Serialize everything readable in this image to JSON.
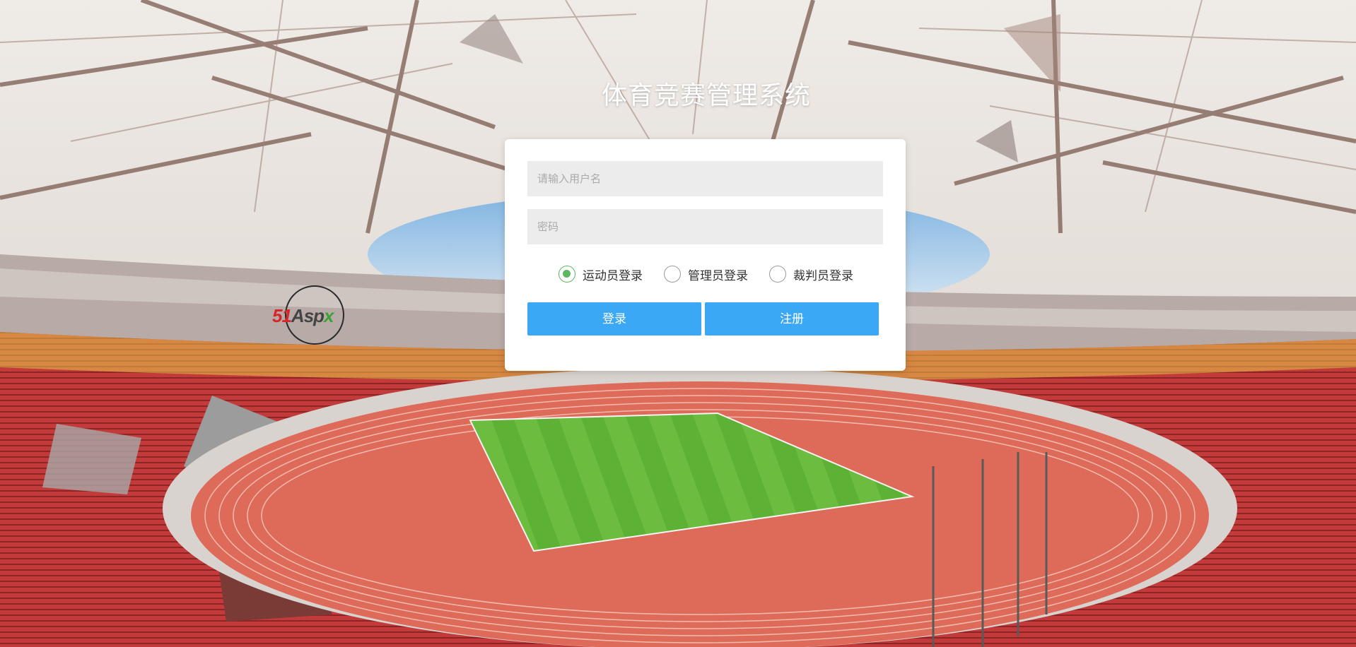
{
  "page": {
    "title": "体育竞赛管理系统"
  },
  "logo": {
    "part1": "51",
    "part2": "Asp",
    "part3": "x"
  },
  "login_form": {
    "username_placeholder": "请输入用户名",
    "username_value": "",
    "password_placeholder": "密码",
    "password_value": "",
    "roles": [
      {
        "label": "运动员登录",
        "checked": true
      },
      {
        "label": "管理员登录",
        "checked": false
      },
      {
        "label": "裁判员登录",
        "checked": false
      }
    ],
    "login_button": "登录",
    "register_button": "注册"
  },
  "colors": {
    "button": "#3aa8f5",
    "radio_checked": "#5cb85c",
    "field_background": "#ececec"
  }
}
